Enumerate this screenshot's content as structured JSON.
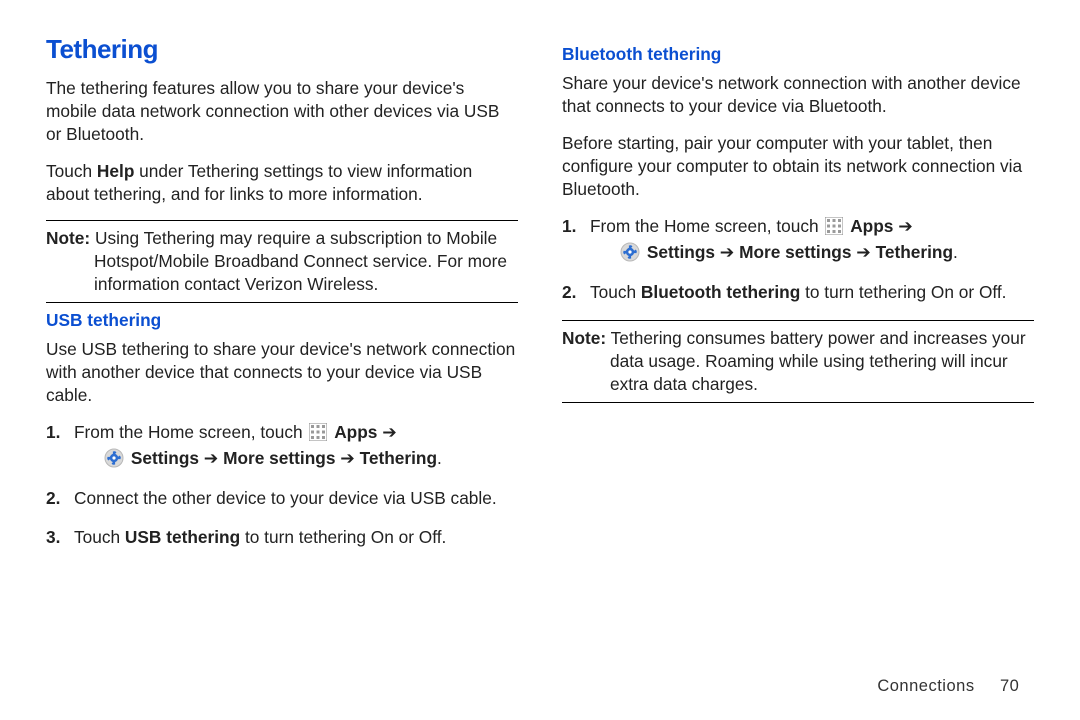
{
  "title": "Tethering",
  "intro_p1": "The tethering features allow you to share your device's mobile data network connection with other devices via USB or Bluetooth.",
  "intro_p2_a": "Touch ",
  "intro_p2_help": "Help",
  "intro_p2_b": " under Tethering settings to view information about tethering, and for links to more information.",
  "note1_label": "Note:",
  "note1_body": " Using Tethering may require a subscription to Mobile Hotspot/Mobile Broadband Connect service. For more information contact Verizon Wireless.",
  "usb": {
    "heading": "USB tethering",
    "desc": "Use USB tethering to share your device's network connection with another device that connects to your device via USB cable.",
    "step1_a": "From the Home screen, touch ",
    "apps_label": "Apps",
    "arrow": "➔",
    "settings_label": "Settings",
    "more_settings_label": "More settings",
    "tethering_label": "Tethering",
    "period": ".",
    "step2": "Connect the other device to your device via USB cable.",
    "step3_a": "Touch ",
    "step3_b": "USB tethering",
    "step3_c": " to turn tethering On or Off."
  },
  "bt": {
    "heading": "Bluetooth tethering",
    "p1": "Share your device's network connection with another device that connects to your device via Bluetooth.",
    "p2": "Before starting, pair your computer with your tablet, then configure your computer to obtain its network connection via Bluetooth.",
    "step1_a": "From the Home screen, touch ",
    "apps_label": "Apps",
    "arrow": "➔",
    "settings_label": "Settings",
    "more_settings_label": "More settings",
    "tethering_label": "Tethering",
    "period": ".",
    "step2_a": "Touch ",
    "step2_b": "Bluetooth tethering",
    "step2_c": " to turn tethering On or Off."
  },
  "note2_label": "Note:",
  "note2_body": " Tethering consumes battery power and increases your data usage. Roaming while using tethering will incur extra data charges.",
  "footer_section": "Connections",
  "footer_page": "70",
  "nums": {
    "n1": "1.",
    "n2": "2.",
    "n3": "3."
  }
}
